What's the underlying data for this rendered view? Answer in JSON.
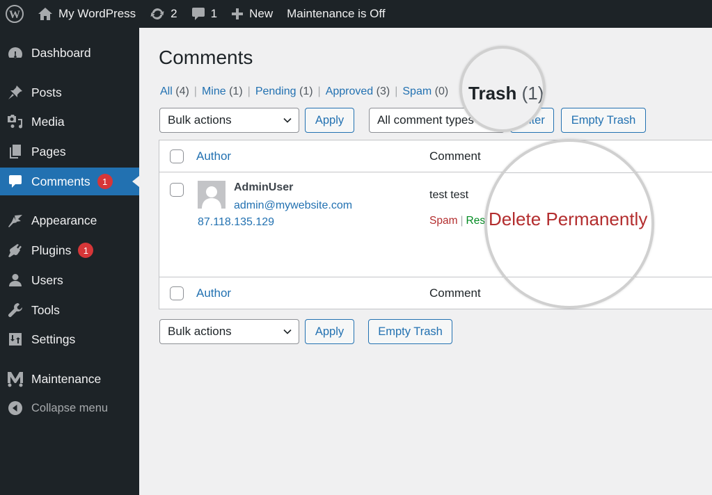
{
  "adminbar": {
    "site_name": "My WordPress",
    "updates_count": "2",
    "comments_count": "1",
    "new_label": "New",
    "maintenance_status": "Maintenance is Off"
  },
  "sidebar": {
    "items": [
      {
        "label": "Dashboard",
        "icon": "dashboard-icon"
      },
      {
        "label": "Posts",
        "icon": "pin-icon"
      },
      {
        "label": "Media",
        "icon": "media-icon"
      },
      {
        "label": "Pages",
        "icon": "pages-icon"
      },
      {
        "label": "Comments",
        "icon": "comment-icon",
        "badge": "1",
        "active": true
      },
      {
        "label": "Appearance",
        "icon": "brush-icon"
      },
      {
        "label": "Plugins",
        "icon": "plugin-icon",
        "badge": "1"
      },
      {
        "label": "Users",
        "icon": "user-icon"
      },
      {
        "label": "Tools",
        "icon": "wrench-icon"
      },
      {
        "label": "Settings",
        "icon": "settings-icon"
      },
      {
        "label": "Maintenance",
        "icon": "maintenance-icon"
      },
      {
        "label": "Collapse menu",
        "icon": "collapse-icon"
      }
    ]
  },
  "main": {
    "title": "Comments",
    "filters": [
      {
        "label": "All",
        "count": "(4)"
      },
      {
        "label": "Mine",
        "count": "(1)"
      },
      {
        "label": "Pending",
        "count": "(1)"
      },
      {
        "label": "Approved",
        "count": "(3)"
      },
      {
        "label": "Spam",
        "count": "(0)"
      },
      {
        "label": "Trash",
        "count": "(1)",
        "current": true
      }
    ],
    "bulk_actions": "Bulk actions",
    "apply_label": "Apply",
    "comment_type": "All comment types",
    "filter_label": "Filter",
    "empty_trash_label": "Empty Trash",
    "table": {
      "col_author": "Author",
      "col_comment": "Comment",
      "rows": [
        {
          "author_name": "AdminUser",
          "author_email": "admin@mywebsite.com",
          "author_ip": "87.118.135.129",
          "comment": "test test",
          "actions": {
            "spam": "Spam",
            "restore": "Restore",
            "delete": "Delete Permanently"
          }
        }
      ]
    }
  },
  "colors": {
    "accent": "#2271b1",
    "adminbar_bg": "#1d2327",
    "badge": "#d63638",
    "delete": "#b32d2e",
    "restore": "#008a20"
  }
}
